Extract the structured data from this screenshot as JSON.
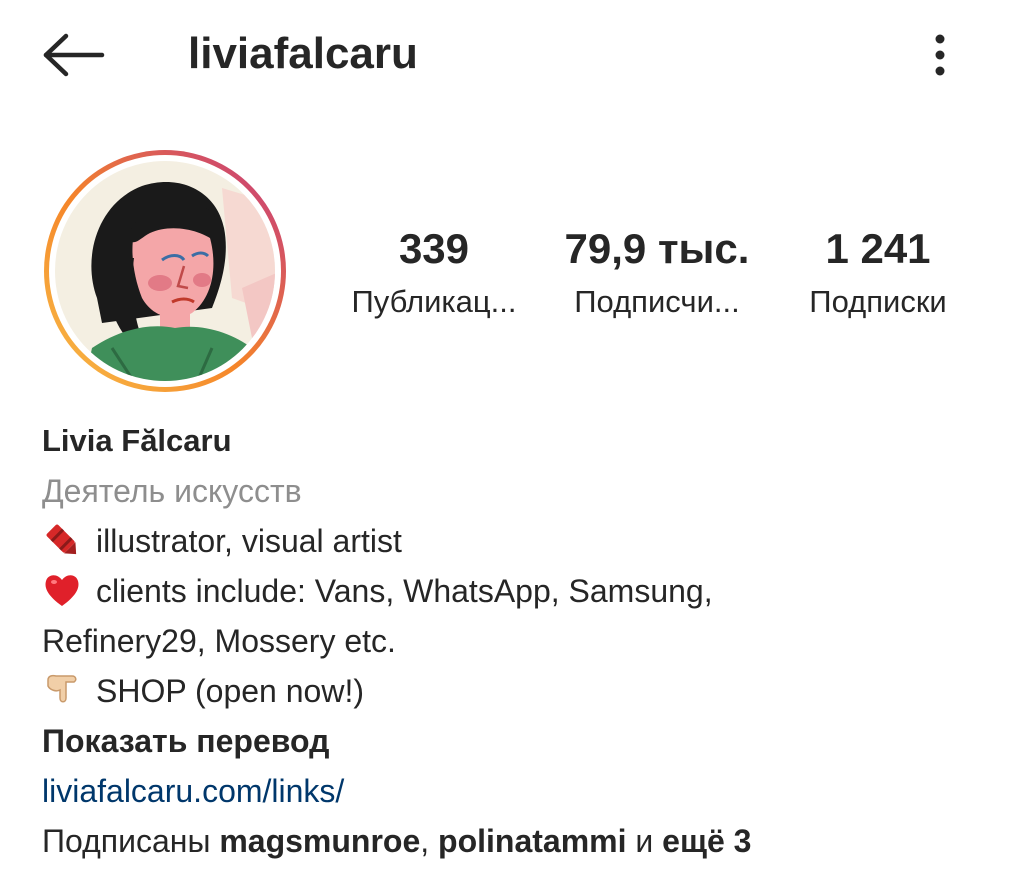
{
  "header": {
    "username": "liviafalcaru"
  },
  "stats": {
    "posts": {
      "count": "339",
      "label": "Публикац..."
    },
    "followers": {
      "count": "79,9 тыс.",
      "label": "Подписчи..."
    },
    "following": {
      "count": "1 241",
      "label": "Подписки"
    }
  },
  "bio": {
    "name": "Livia Fălcaru",
    "category": "Деятель искусств",
    "line1": "illustrator, visual artist",
    "line2": "clients include: Vans, WhatsApp, Samsung,",
    "line3": "Refinery29, Mossery etc.",
    "line4": "SHOP (open now!)",
    "translate": "Показать перевод",
    "link": "liviafalcaru.com/links/",
    "followed_prefix": "Подписаны",
    "followed_user1": "magsmunroe",
    "followed_sep": ",",
    "followed_user2": "polinatammi",
    "followed_and": "и",
    "followed_more": "ещё 3"
  },
  "colors": {
    "text": "#262626",
    "muted": "#8e8e8e",
    "link": "#00376b",
    "ring_start": "#f58529",
    "ring_end": "#c13584"
  },
  "icons": {
    "back": "arrow-left-icon",
    "more": "more-vertical-icon",
    "crayon": "crayon-emoji-icon",
    "heart": "red-heart-emoji-icon",
    "point": "pointing-down-emoji-icon"
  }
}
